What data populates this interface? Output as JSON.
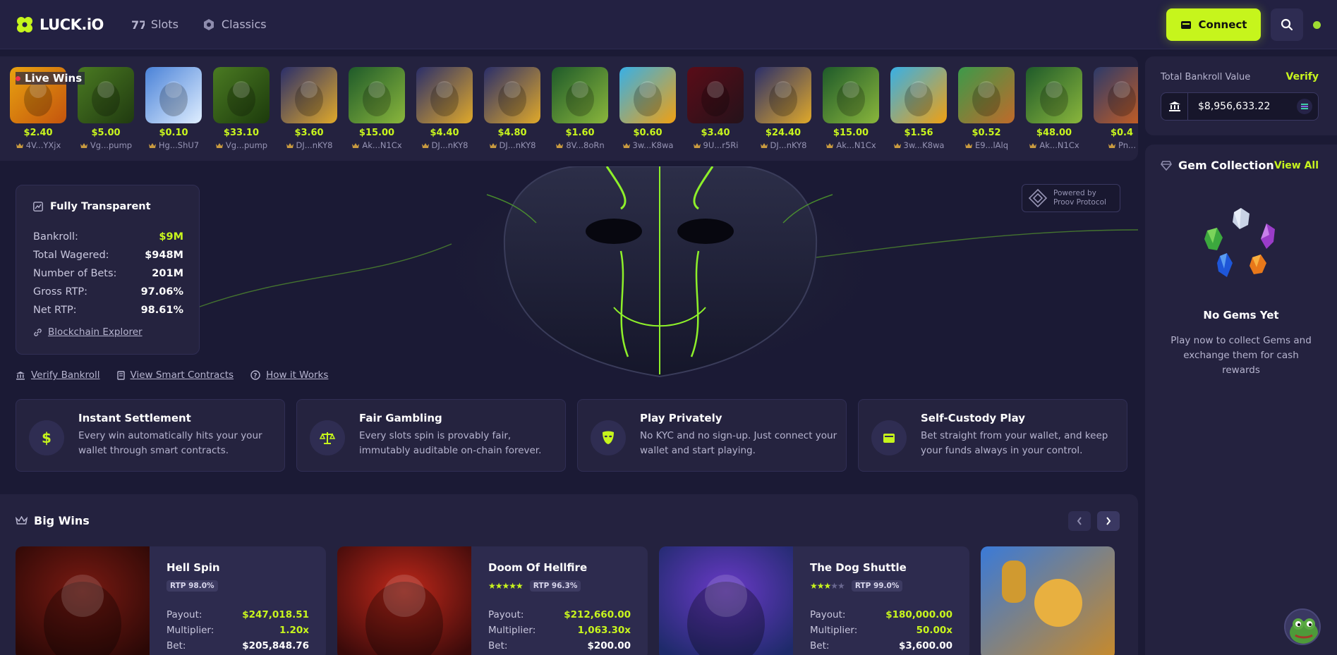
{
  "header": {
    "logo_text": "LUCK.iO",
    "nav": [
      {
        "label": "Slots",
        "icon": "slots-icon"
      },
      {
        "label": "Classics",
        "icon": "classics-icon"
      }
    ],
    "connect_label": "Connect",
    "accent_color": "#c6f51c"
  },
  "live_wins": {
    "title": "Live Wins",
    "items": [
      {
        "amount": "$2.40",
        "user": "4V...YXjx",
        "colors": [
          "#e8a210",
          "#c4540d"
        ]
      },
      {
        "amount": "$5.00",
        "user": "Vg...pump",
        "colors": [
          "#4a7a22",
          "#203a10"
        ]
      },
      {
        "amount": "$0.10",
        "user": "Hg...ShU7",
        "colors": [
          "#4a82d8",
          "#dfeeff"
        ]
      },
      {
        "amount": "$33.10",
        "user": "Vg...pump",
        "colors": [
          "#4a7a22",
          "#1c3a0c"
        ]
      },
      {
        "amount": "$3.60",
        "user": "DJ...nKY8",
        "colors": [
          "#2a2e6a",
          "#e0a92a"
        ]
      },
      {
        "amount": "$15.00",
        "user": "Ak...N1Cx",
        "colors": [
          "#1e5a2a",
          "#8ab63c"
        ]
      },
      {
        "amount": "$4.40",
        "user": "DJ...nKY8",
        "colors": [
          "#2a2e6a",
          "#e0a92a"
        ]
      },
      {
        "amount": "$4.80",
        "user": "DJ...nKY8",
        "colors": [
          "#2a2e6a",
          "#e0a92a"
        ]
      },
      {
        "amount": "$1.60",
        "user": "8V...8oRn",
        "colors": [
          "#1e5a2a",
          "#8ab63c"
        ]
      },
      {
        "amount": "$0.60",
        "user": "3w...K8wa",
        "colors": [
          "#38b0e6",
          "#f0a012"
        ]
      },
      {
        "amount": "$3.40",
        "user": "9U...r5Ri",
        "colors": [
          "#5a0c18",
          "#24121a"
        ]
      },
      {
        "amount": "$24.40",
        "user": "DJ...nKY8",
        "colors": [
          "#2a2e6a",
          "#e0a92a"
        ]
      },
      {
        "amount": "$15.00",
        "user": "Ak...N1Cx",
        "colors": [
          "#1e5a2a",
          "#8ab63c"
        ]
      },
      {
        "amount": "$1.56",
        "user": "3w...K8wa",
        "colors": [
          "#38b0e6",
          "#f0a012"
        ]
      },
      {
        "amount": "$0.52",
        "user": "E9...lAlq",
        "colors": [
          "#3c9a4a",
          "#c06a2a"
        ]
      },
      {
        "amount": "$48.00",
        "user": "Ak...N1Cx",
        "colors": [
          "#1e5a2a",
          "#8ab63c"
        ]
      },
      {
        "amount": "$0.4",
        "user": "Pn...",
        "colors": [
          "#2c3a6a",
          "#d0601e"
        ]
      }
    ]
  },
  "bankroll": {
    "label": "Total Bankroll Value",
    "verify_label": "Verify",
    "value": "$8,956,633.22"
  },
  "gems": {
    "title": "Gem Collection",
    "view_all": "View All",
    "empty_title": "No Gems Yet",
    "empty_desc": "Play now to collect Gems and exchange them for cash rewards"
  },
  "hero": {
    "stats_title": "Fully Transparent",
    "stats": [
      {
        "label": "Bankroll:",
        "value": "$9M",
        "highlight": true
      },
      {
        "label": "Total Wagered:",
        "value": "$948M",
        "highlight": false
      },
      {
        "label": "Number of Bets:",
        "value": "201M",
        "highlight": false
      },
      {
        "label": "Gross RTP:",
        "value": "97.06%",
        "highlight": false
      },
      {
        "label": "Net RTP:",
        "value": "98.61%",
        "highlight": false
      }
    ],
    "explorer_label": "Blockchain Explorer",
    "powered_line1": "Powered by",
    "powered_line2": "Proov Protocol",
    "links": [
      "Verify Bankroll",
      "View Smart Contracts",
      "How it Works"
    ]
  },
  "features": [
    {
      "title": "Instant Settlement",
      "desc": "Every win automatically hits your your wallet through smart contracts.",
      "icon": "dollar-icon"
    },
    {
      "title": "Fair Gambling",
      "desc": "Every slots spin is provably fair, immutably auditable on-chain forever.",
      "icon": "scale-icon"
    },
    {
      "title": "Play Privately",
      "desc": "No KYC and no sign-up. Just connect your wallet and start playing.",
      "icon": "mask-icon"
    },
    {
      "title": "Self-Custody Play",
      "desc": "Bet straight from your wallet, and keep your funds always in your control.",
      "icon": "wallet-icon"
    }
  ],
  "big_wins": {
    "title": "Big Wins",
    "payout_label": "Payout:",
    "multiplier_label": "Multiplier:",
    "bet_label": "Bet:",
    "items": [
      {
        "name": "Hell Spin",
        "stars": 0,
        "rtp": "RTP 98.0%",
        "payout": "$247,018.51",
        "multiplier": "1.20x",
        "bet": "$205,848.76",
        "colors": [
          "#7a1a12",
          "#2a0806"
        ]
      },
      {
        "name": "Doom Of Hellfire",
        "stars": 5,
        "rtp": "RTP 96.3%",
        "payout": "$212,660.00",
        "multiplier": "1,063.30x",
        "bet": "$200.00",
        "colors": [
          "#c0281a",
          "#3a0a0a"
        ]
      },
      {
        "name": "The Dog Shuttle",
        "stars": 3,
        "rtp": "RTP 99.0%",
        "payout": "$180,000.00",
        "multiplier": "50.00x",
        "bet": "$3,600.00",
        "colors": [
          "#6a3ac8",
          "#1e2a6a"
        ]
      }
    ]
  }
}
